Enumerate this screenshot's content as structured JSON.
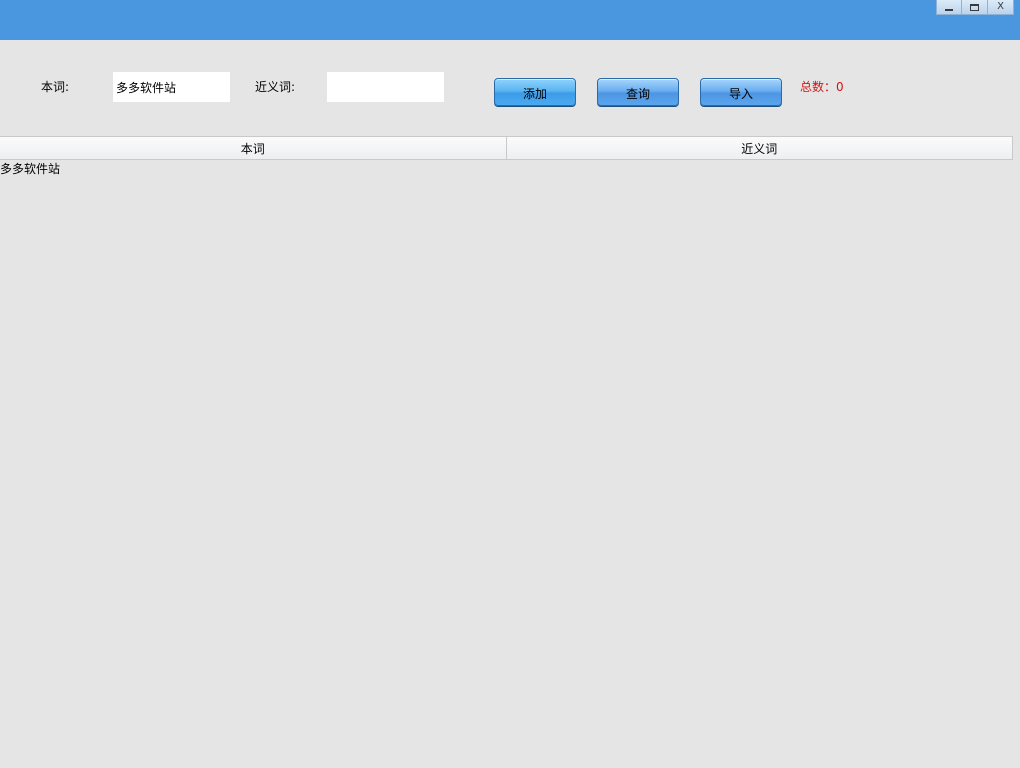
{
  "window": {
    "controls": {
      "minimize": "",
      "maximize": "",
      "close": "X"
    }
  },
  "form": {
    "word_label": "本词:",
    "word_value": "多多软件站",
    "synonym_label": "近义词:",
    "synonym_value": "",
    "add_button": "添加",
    "query_button": "查询",
    "import_button": "导入",
    "total_text": "总数：0"
  },
  "table": {
    "columns": [
      "本词",
      "近义词"
    ],
    "rows": [
      [
        "多多软件站",
        ""
      ]
    ]
  },
  "colors": {
    "title_bar": "#4a97e0",
    "background": "#e5e5e5",
    "total_text": "#d31414",
    "button": "#4aaaf0"
  }
}
